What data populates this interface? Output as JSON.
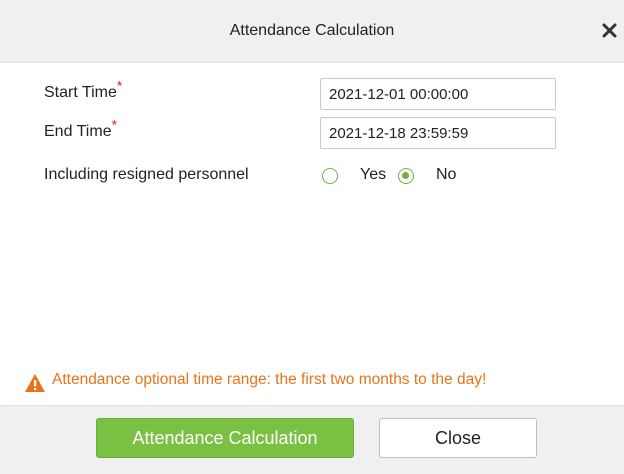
{
  "dialog": {
    "title": "Attendance Calculation",
    "close_icon": "close-icon"
  },
  "form": {
    "start_time": {
      "label": "Start Time",
      "required_mark": "*",
      "value": "2021-12-01 00:00:00"
    },
    "end_time": {
      "label": "End Time",
      "required_mark": "*",
      "value": "2021-12-18 23:59:59"
    },
    "resigned": {
      "label": "Including resigned personnel",
      "options": [
        {
          "label": "Yes",
          "selected": false
        },
        {
          "label": "No",
          "selected": true
        }
      ]
    }
  },
  "warning": {
    "icon": "warning-icon",
    "text": "Attendance optional time range: the first two months to the day!"
  },
  "footer": {
    "primary_label": "Attendance Calculation",
    "close_label": "Close"
  },
  "colors": {
    "accent": "#7ac143",
    "warning": "#e8741a",
    "required": "#e02020"
  }
}
